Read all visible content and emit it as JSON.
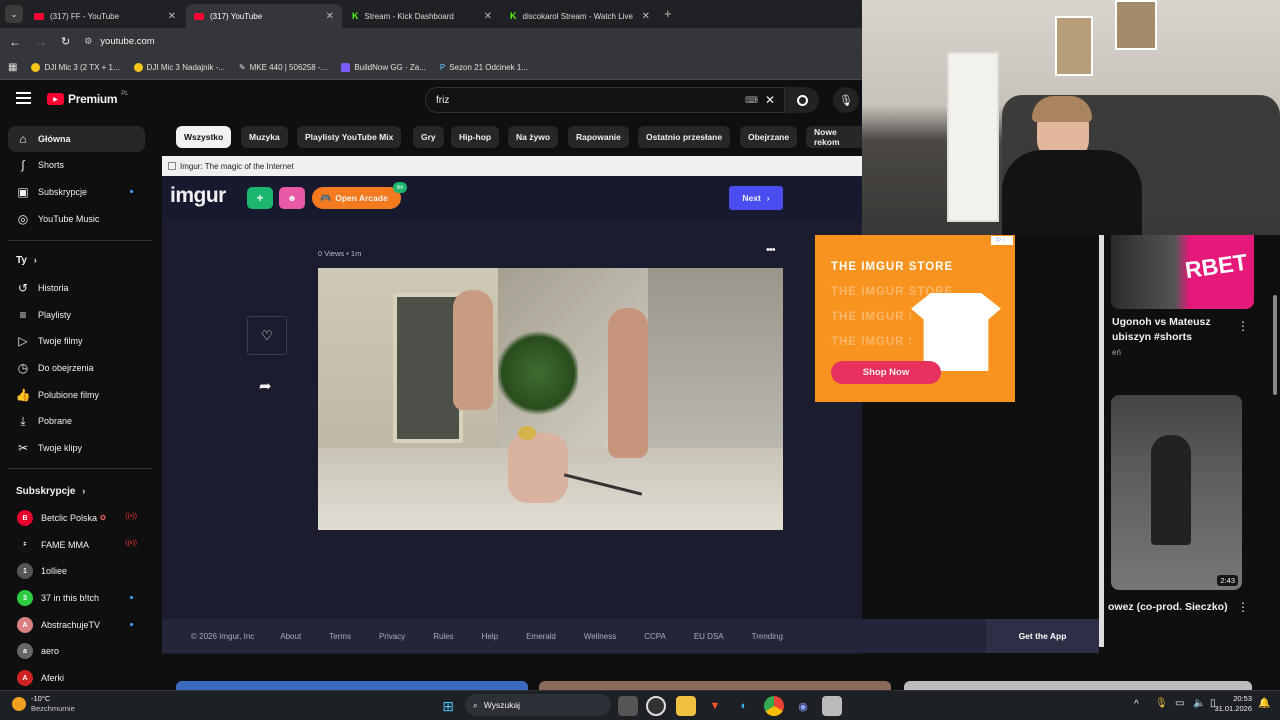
{
  "browser": {
    "tabs": [
      {
        "title": "(317) FF - YouTube",
        "icon": "youtube-icon",
        "active": false
      },
      {
        "title": "(317) YouTube",
        "icon": "youtube-icon",
        "active": true
      },
      {
        "title": "Stream - Kick Dashboard",
        "icon": "kick-icon",
        "active": false
      },
      {
        "title": "discokarol Stream - Watch Live",
        "icon": "kick-icon",
        "active": false
      }
    ],
    "url": "youtube.com",
    "bookmarks": [
      "DJI Mic 3 (2 TX + 1...",
      "DJI Mic 3 Nadajnik -...",
      "MKE 440 | 506258 -...",
      "BuildNow GG · Za...",
      "Sezon 21 Odcinek 1..."
    ]
  },
  "youtube": {
    "logo": "Premium",
    "logo_region": "PL",
    "search_value": "friz",
    "chips": [
      "Wszystko",
      "Muzyka",
      "Playlisty YouTube Mix",
      "Gry",
      "Hip-hop",
      "Na żywo",
      "Rapowanie",
      "Ostatnio przesłane",
      "Obejrzane",
      "Nowe rekom"
    ],
    "nav_main": [
      {
        "label": "Główna",
        "icon": "home-icon",
        "active": true
      },
      {
        "label": "Shorts",
        "icon": "shorts-icon"
      },
      {
        "label": "Subskrypcje",
        "icon": "subscriptions-icon",
        "dot": true
      },
      {
        "label": "YouTube Music",
        "icon": "youtube-music-icon"
      }
    ],
    "you_header": "Ty",
    "nav_you": [
      {
        "label": "Historia",
        "icon": "history-icon"
      },
      {
        "label": "Playlisty",
        "icon": "playlists-icon"
      },
      {
        "label": "Twoje filmy",
        "icon": "your-videos-icon"
      },
      {
        "label": "Do obejrzenia",
        "icon": "watch-later-icon"
      },
      {
        "label": "Polubione filmy",
        "icon": "liked-icon"
      },
      {
        "label": "Pobrane",
        "icon": "download-icon"
      },
      {
        "label": "Twoje klipy",
        "icon": "clips-icon"
      }
    ],
    "subs_header": "Subskrypcje",
    "subs": [
      {
        "label": "Betclic Polska",
        "color": "#e4002b",
        "initial": "B",
        "live": true,
        "verified": true
      },
      {
        "label": "FAME MMA",
        "color": "#111111",
        "initial": "F",
        "live": true
      },
      {
        "label": "1olliee",
        "color": "#555555",
        "initial": "1"
      },
      {
        "label": "37 in this b!tch",
        "color": "#2ecc40",
        "initial": "3",
        "dot": true
      },
      {
        "label": "AbstrachujeTV",
        "color": "#d98080",
        "initial": "A",
        "dot": true
      },
      {
        "label": "aero",
        "color": "#666666",
        "initial": "a"
      },
      {
        "label": "Aferki",
        "color": "#cc2222",
        "initial": "A"
      }
    ]
  },
  "modal": {
    "window_title": "Imgur: The magic of the Internet",
    "logo": "imgur",
    "arcade_label": "Open Arcade",
    "arcade_badge": "9th",
    "next_label": "Next",
    "post_meta": "0 Views • 1m",
    "ad": {
      "title": "THE IMGUR STORE",
      "echo": "THE IMGUR STORE",
      "cta": "Shop Now"
    },
    "footer_links": [
      "© 2026 Imgur, Inc",
      "About",
      "Terms",
      "Privacy",
      "Rules",
      "Help",
      "Emerald",
      "Wellness",
      "CCPA",
      "EU DSA",
      "Trending"
    ],
    "get_app": "Get the App"
  },
  "right_feed": {
    "short_title_1": "Ugonoh vs Mateusz",
    "short_title_2": "ubiszyn #shorts",
    "short_meta": "eń",
    "duration": "2:43",
    "video_title": "owez (co-prod. Sieczko)",
    "promo_text": "RBET"
  },
  "taskbar": {
    "weather_temp": "-10°C",
    "weather_desc": "Bezchmurnie",
    "search": "Wyszukaj",
    "time": "20:53",
    "date": "31.01.2026"
  },
  "colors": {
    "youtube_red": "#ff0033",
    "imgur_next": "#4a4ef0",
    "arcade": "#f47a20",
    "ad_bg": "#f7931e",
    "shop_now": "#e8315f"
  }
}
